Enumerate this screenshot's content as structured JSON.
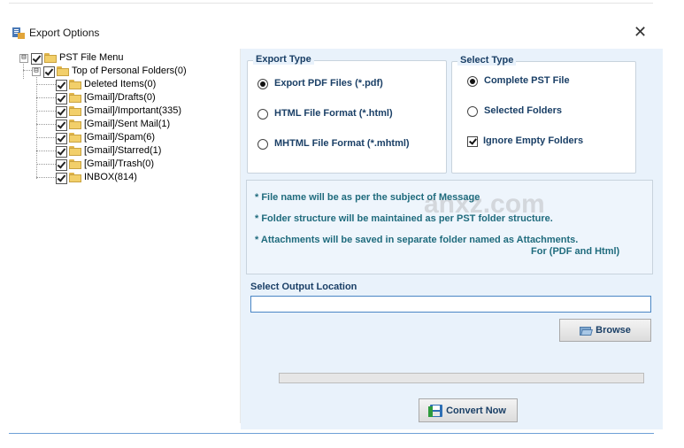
{
  "window": {
    "title": "Export Options",
    "close_glyph": "✕"
  },
  "tree": {
    "root": {
      "label": "PST File Menu",
      "expander": "⊟"
    },
    "personal": {
      "label": "Top of Personal Folders(0)",
      "expander": "⊟"
    },
    "folders": [
      {
        "label": "Deleted Items(0)"
      },
      {
        "label": "[Gmail]/Drafts(0)"
      },
      {
        "label": "[Gmail]/Important(335)"
      },
      {
        "label": "[Gmail]/Sent Mail(1)"
      },
      {
        "label": "[Gmail]/Spam(6)"
      },
      {
        "label": "[Gmail]/Starred(1)"
      },
      {
        "label": "[Gmail]/Trash(0)"
      },
      {
        "label": "INBOX(814)"
      }
    ]
  },
  "export_type": {
    "title": "Export Type",
    "options": [
      {
        "label": "Export PDF Files (*.pdf)",
        "selected": true
      },
      {
        "label": "HTML File  Format (*.html)",
        "selected": false
      },
      {
        "label": "MHTML File  Format (*.mhtml)",
        "selected": false
      }
    ]
  },
  "select_type": {
    "title": "Select Type",
    "options": [
      {
        "label": "Complete PST File",
        "selected": true
      },
      {
        "label": "Selected Folders",
        "selected": false
      }
    ],
    "ignore_empty": {
      "label": "Ignore Empty Folders",
      "checked": true
    }
  },
  "info": {
    "line1": "* File name will be as per the subject of Message",
    "line2": "* Folder structure will be maintained as per PST folder structure.",
    "line3": "* Attachments will be saved in separate folder named as Attachments.",
    "line4": "For (PDF and Html)",
    "watermark": "anxz.com"
  },
  "output": {
    "label": "Select Output Location",
    "value": "",
    "browse_label": "Browse"
  },
  "progress": {
    "fraction": 0
  },
  "convert_label": "Convert Now",
  "colors": {
    "accent_text": "#1a3f66",
    "info_text": "#1f6b7d",
    "panel_bg": "#e9f2fb",
    "input_border": "#4a86c5"
  },
  "icons": {
    "title": "export-options-icon",
    "folder": "folder-icon",
    "browse": "folder-open-icon",
    "convert": "save-disk-icon"
  }
}
